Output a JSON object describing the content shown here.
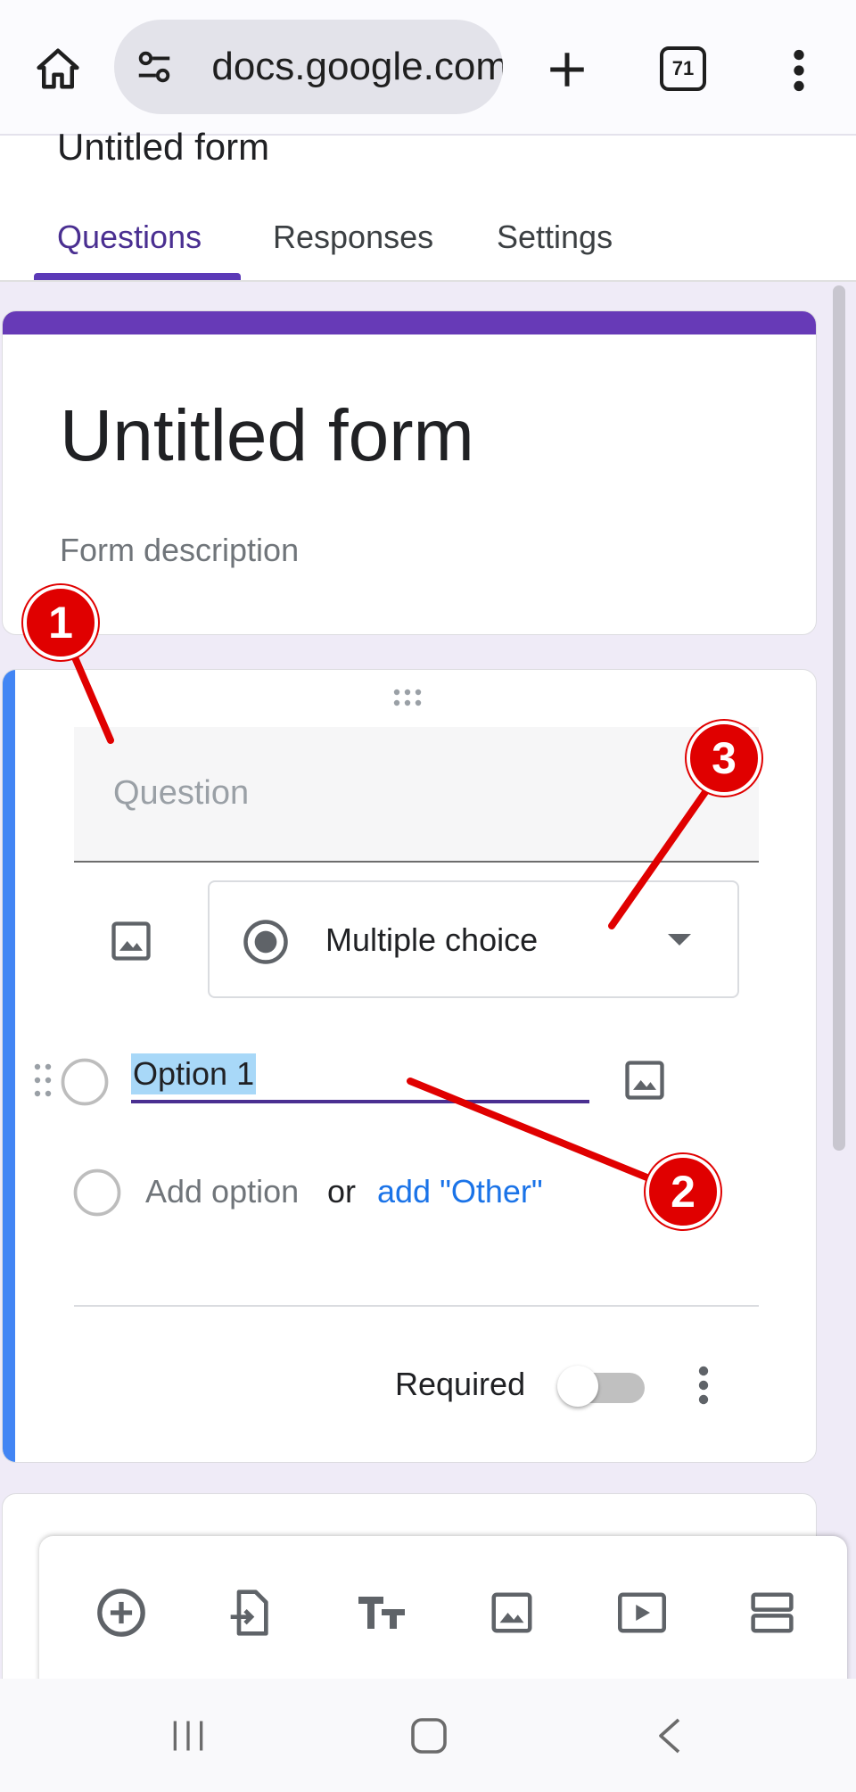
{
  "browser": {
    "url": "docs.google.com",
    "tab_count": "71",
    "icons": [
      "home-icon",
      "site-settings-icon",
      "plus-icon",
      "tab-switcher-icon",
      "more-vert-icon"
    ]
  },
  "form_header": {
    "title": "Untitled form",
    "tabs": [
      {
        "label": "Questions",
        "active": true
      },
      {
        "label": "Responses",
        "active": false
      },
      {
        "label": "Settings",
        "active": false
      }
    ]
  },
  "title_card": {
    "title": "Untitled form",
    "description_placeholder": "Form description",
    "accent_color": "#673ab7"
  },
  "question_card": {
    "question_placeholder": "Question",
    "type": "Multiple choice",
    "options": [
      {
        "label": "Option 1",
        "selected_text": true
      }
    ],
    "add_option": "Add option",
    "or": "or",
    "add_other": "add \"Other\"",
    "required_label": "Required",
    "required": false,
    "accent_color": "#4285f4"
  },
  "toolbar": {
    "tools": [
      "add-question-icon",
      "import-questions-icon",
      "add-title-icon",
      "add-image-icon",
      "add-video-icon",
      "add-section-icon"
    ]
  },
  "nav_bar": {
    "buttons": [
      "recents-icon",
      "home-icon",
      "back-icon"
    ]
  },
  "annotations": {
    "markers": [
      "1",
      "2",
      "3"
    ],
    "color": "#e00000"
  }
}
